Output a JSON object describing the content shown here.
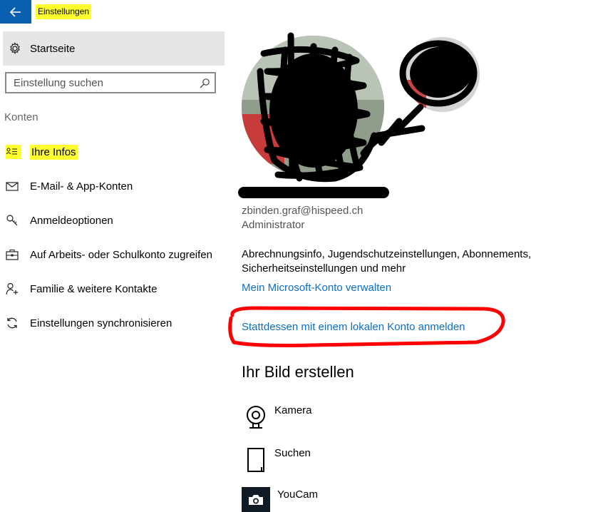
{
  "window": {
    "title": "Einstellungen",
    "back_icon": "back-arrow-icon",
    "colors": {
      "accent": "#0a5fb0",
      "highlight": "#ffff2e",
      "link": "#0b6ec7",
      "annotation": "#ff0000"
    }
  },
  "sidebar": {
    "home_label": "Startseite",
    "home_icon": "gear-icon",
    "search_placeholder": "Einstellung suchen",
    "search_icon": "search-icon",
    "section_label": "Konten",
    "items": [
      {
        "label": "Ihre Infos",
        "icon": "person-card-icon",
        "active": true
      },
      {
        "label": "E-Mail- & App-Konten",
        "icon": "mail-icon",
        "active": false
      },
      {
        "label": "Anmeldeoptionen",
        "icon": "key-icon",
        "active": false
      },
      {
        "label": "Auf Arbeits- oder Schulkonto zugreifen",
        "icon": "briefcase-icon",
        "active": false
      },
      {
        "label": "Familie & weitere Kontakte",
        "icon": "person-add-icon",
        "active": false
      },
      {
        "label": "Einstellungen synchronisieren",
        "icon": "sync-icon",
        "active": false
      }
    ]
  },
  "account": {
    "email": "zbinden.graf@hispeed.ch",
    "role": "Administrator",
    "billing_info": "Abrechnungsinfo, Jugendschutzeinstellungen, Abonnements, Sicherheitseinstellungen und mehr",
    "manage_link": "Mein Microsoft-Konto verwalten",
    "local_account_link": "Stattdessen mit einem lokalen Konto anmelden"
  },
  "create_picture": {
    "title": "Ihr Bild erstellen",
    "items": [
      {
        "label": "Kamera",
        "icon": "webcam-icon"
      },
      {
        "label": "Suchen",
        "icon": "file-browse-icon"
      },
      {
        "label": "YouCam",
        "icon": "camera-app-icon"
      }
    ]
  }
}
